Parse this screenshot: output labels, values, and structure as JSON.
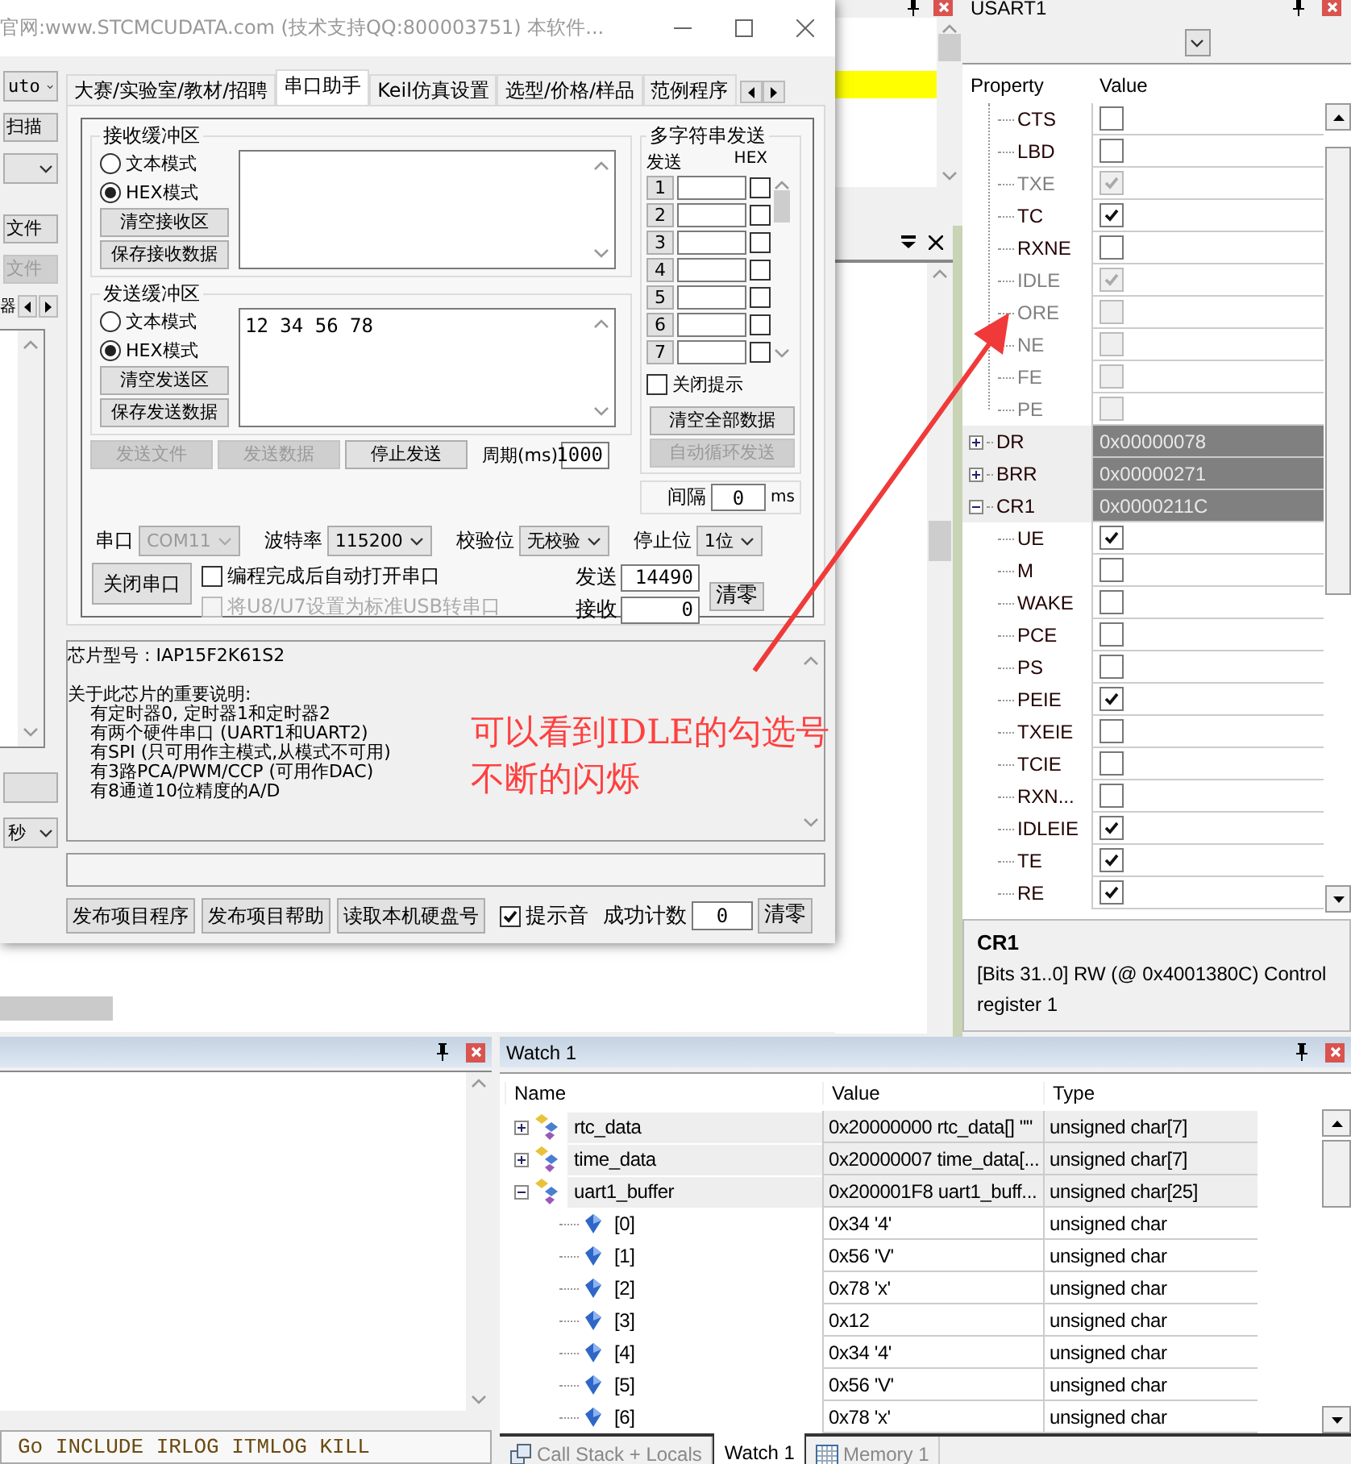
{
  "stc": {
    "title": "官网:www.STCMCUDATA.com  (技术支持QQ:800003751) 本软件...",
    "side": {
      "combo": "uto",
      "scan_button": "扫描",
      "file_button": "文件",
      "file_button_disabled": "文件",
      "pager_label": "器",
      "unit_combo": "秒"
    },
    "tabs": [
      {
        "label": "大赛/实验室/教材/招聘",
        "selected": false
      },
      {
        "label": "串口助手",
        "selected": true
      },
      {
        "label": "Keil仿真设置",
        "selected": false
      },
      {
        "label": "选型/价格/样品",
        "selected": false
      },
      {
        "label": "范例程序",
        "selected": false
      }
    ],
    "receive": {
      "title": "接收缓冲区",
      "modes": [
        {
          "label": "文本模式",
          "selected": false
        },
        {
          "label": "HEX模式",
          "selected": true
        }
      ],
      "buttons": [
        "清空接收区",
        "保存接收数据"
      ]
    },
    "send": {
      "title": "发送缓冲区",
      "modes": [
        {
          "label": "文本模式",
          "selected": false
        },
        {
          "label": "HEX模式",
          "selected": true
        }
      ],
      "buttons": [
        "清空发送区",
        "保存发送数据"
      ],
      "content": "12 34 56 78"
    },
    "actions": [
      {
        "label": "发送文件",
        "disabled": true
      },
      {
        "label": "发送数据",
        "disabled": true
      },
      {
        "label": "停止发送",
        "disabled": false
      }
    ],
    "period": {
      "label": "周期(ms)",
      "value": "1000"
    },
    "multi": {
      "title": "多字符串发送",
      "send_header": "发送",
      "hex_header": "HEX",
      "rows": [
        {
          "number": "1",
          "hex": false
        },
        {
          "number": "2",
          "hex": false
        },
        {
          "number": "3",
          "hex": false
        },
        {
          "number": "4",
          "hex": false
        },
        {
          "number": "5",
          "hex": false
        },
        {
          "number": "6",
          "hex": false
        },
        {
          "number": "7",
          "hex": false
        }
      ],
      "close_hint": {
        "label": "关闭提示",
        "checked": false
      },
      "buttons": [
        {
          "label": "清空全部数据",
          "disabled": false
        },
        {
          "label": "自动循环发送",
          "disabled": true
        }
      ],
      "interval": {
        "label": "间隔",
        "value": "0",
        "unit": "ms"
      }
    },
    "settings": [
      {
        "label": "串口",
        "value": "COM11",
        "disabled": true
      },
      {
        "label": "波特率",
        "value": "115200",
        "disabled": false
      },
      {
        "label": "校验位",
        "value": "无校验",
        "disabled": false
      },
      {
        "label": "停止位",
        "value": "1位",
        "disabled": false
      }
    ],
    "close_port": "关闭串口",
    "options": [
      {
        "label": "编程完成后自动打开串口",
        "checked": false,
        "disabled": false
      },
      {
        "label": "将U8/U7设置为标准USB转串口",
        "checked": false,
        "disabled": true
      }
    ],
    "counters": [
      {
        "label": "发送",
        "value": "14490"
      },
      {
        "label": "接收",
        "value": "0"
      }
    ],
    "reset_button": "清零",
    "info": {
      "chip": "芯片型号 : IAP15F2K61S2",
      "notes_title": "关于此芯片的重要说明:",
      "notes": [
        "有定时器0, 定时器1和定时器2",
        "有两个硬件串口 (UART1和UART2)",
        "有SPI (只可用作主模式,从模式不可用)",
        "有3路PCA/PWM/CCP (可用作DAC)",
        "有8通道10位精度的A/D"
      ]
    },
    "footer": {
      "buttons": [
        "发布项目程序",
        "发布项目帮助",
        "读取本机硬盘号"
      ],
      "beep": {
        "label": "提示音",
        "checked": true
      },
      "count": {
        "label": "成功计数",
        "value": "0"
      },
      "reset_button": "清零"
    }
  },
  "peripheral": {
    "title": "USART1",
    "columns": [
      "Property",
      "Value"
    ],
    "tree": [
      {
        "kind": "group",
        "expanded": true,
        "children": [
          {
            "kind": "bit",
            "name": "CTS",
            "checked": false,
            "disabled": false
          },
          {
            "kind": "bit",
            "name": "LBD",
            "checked": false,
            "disabled": false
          },
          {
            "kind": "bit",
            "name": "TXE",
            "checked": true,
            "disabled": true
          },
          {
            "kind": "bit",
            "name": "TC",
            "checked": true,
            "disabled": false
          },
          {
            "kind": "bit",
            "name": "RXNE",
            "checked": false,
            "disabled": false
          },
          {
            "kind": "bit",
            "name": "IDLE",
            "checked": true,
            "disabled": true
          },
          {
            "kind": "bit",
            "name": "ORE",
            "checked": false,
            "disabled": true
          },
          {
            "kind": "bit",
            "name": "NE",
            "checked": false,
            "disabled": true
          },
          {
            "kind": "bit",
            "name": "FE",
            "checked": false,
            "disabled": true
          },
          {
            "kind": "bit",
            "name": "PE",
            "checked": false,
            "disabled": true
          }
        ]
      },
      {
        "kind": "register",
        "name": "DR",
        "value": "0x00000078",
        "expanded": false
      },
      {
        "kind": "register",
        "name": "BRR",
        "value": "0x00000271",
        "expanded": false
      },
      {
        "kind": "register",
        "name": "CR1",
        "value": "0x0000211C",
        "expanded": true,
        "children": [
          {
            "kind": "bit",
            "name": "UE",
            "checked": true,
            "disabled": false
          },
          {
            "kind": "bit",
            "name": "M",
            "checked": false,
            "disabled": false
          },
          {
            "kind": "bit",
            "name": "WAKE",
            "checked": false,
            "disabled": false
          },
          {
            "kind": "bit",
            "name": "PCE",
            "checked": false,
            "disabled": false
          },
          {
            "kind": "bit",
            "name": "PS",
            "checked": false,
            "disabled": false
          },
          {
            "kind": "bit",
            "name": "PEIE",
            "checked": true,
            "disabled": false
          },
          {
            "kind": "bit",
            "name": "TXEIE",
            "checked": false,
            "disabled": false
          },
          {
            "kind": "bit",
            "name": "TCIE",
            "checked": false,
            "disabled": false
          },
          {
            "kind": "bit",
            "name": "RXN...",
            "checked": false,
            "disabled": false
          },
          {
            "kind": "bit",
            "name": "IDLEIE",
            "checked": true,
            "disabled": false
          },
          {
            "kind": "bit",
            "name": "TE",
            "checked": true,
            "disabled": false
          },
          {
            "kind": "bit",
            "name": "RE",
            "checked": true,
            "disabled": false
          }
        ]
      }
    ],
    "info": {
      "title": "CR1",
      "description": "[Bits 31..0] RW (@ 0x4001380C) Control register 1"
    }
  },
  "watch": {
    "title": "Watch 1",
    "columns": [
      "Name",
      "Value",
      "Type"
    ],
    "rows": [
      {
        "name": "rtc_data",
        "value": "0x20000000 rtc_data[] \"\"",
        "type": "unsigned char[7]",
        "expanded": false
      },
      {
        "name": "time_data",
        "value": "0x20000007 time_data[...",
        "type": "unsigned char[7]",
        "expanded": false
      },
      {
        "name": "uart1_buffer",
        "value": "0x200001F8 uart1_buff...",
        "type": "unsigned char[25]",
        "expanded": true,
        "children": [
          {
            "name": "[0]",
            "value": "0x34 '4'",
            "type": "unsigned char"
          },
          {
            "name": "[1]",
            "value": "0x56 'V'",
            "type": "unsigned char"
          },
          {
            "name": "[2]",
            "value": "0x78 'x'",
            "type": "unsigned char"
          },
          {
            "name": "[3]",
            "value": "0x12",
            "type": "unsigned char"
          },
          {
            "name": "[4]",
            "value": "0x34 '4'",
            "type": "unsigned char"
          },
          {
            "name": "[5]",
            "value": "0x56 'V'",
            "type": "unsigned char"
          },
          {
            "name": "[6]",
            "value": "0x78 'x'",
            "type": "unsigned char"
          }
        ]
      }
    ],
    "tabs": [
      {
        "label": "Call Stack + Locals",
        "selected": false
      },
      {
        "label": "Watch 1",
        "selected": true
      },
      {
        "label": "Memory 1",
        "selected": false
      }
    ]
  },
  "command_line": "Go INCLUDE IRLOG ITMLOG KILL",
  "annotation": {
    "lines": [
      "可以看到IDLE的勾选号",
      "不断的闪烁"
    ]
  }
}
